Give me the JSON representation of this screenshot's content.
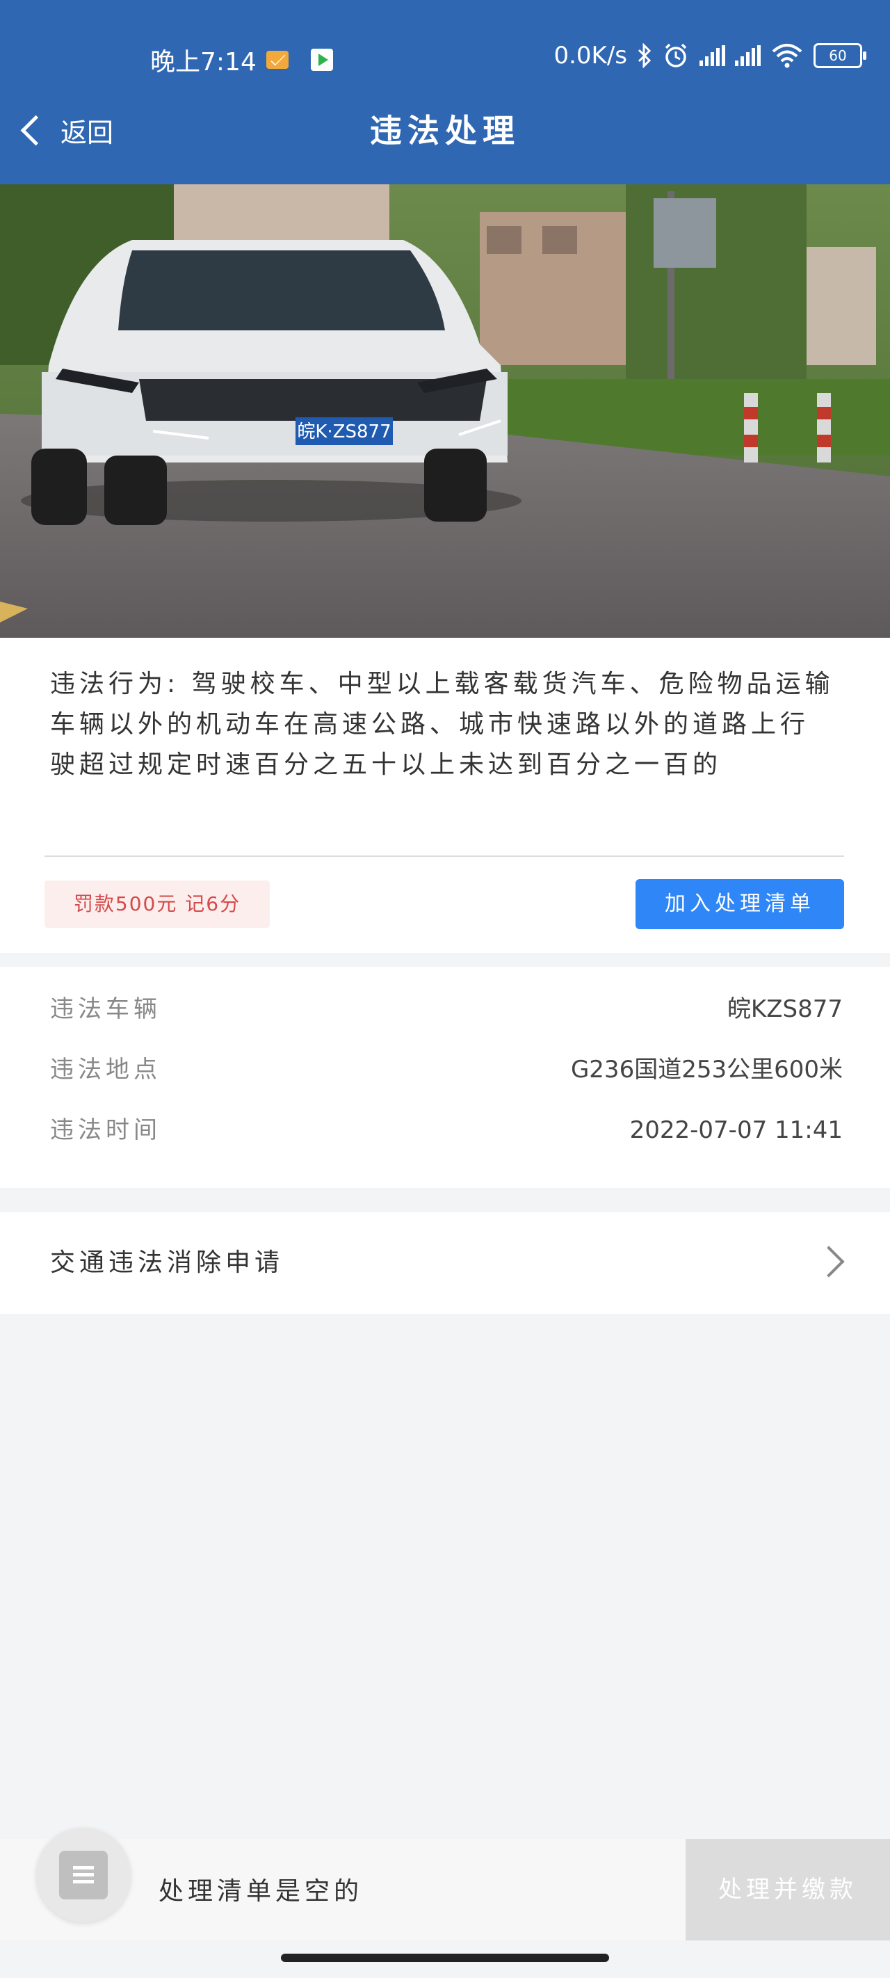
{
  "status_bar": {
    "time": "晚上7:14",
    "network_speed": "0.0K/s",
    "battery": "60",
    "icons": [
      "mail-icon",
      "play-store-icon",
      "bluetooth-icon",
      "alarm-icon",
      "signal-icon",
      "wifi-icon",
      "battery-icon"
    ]
  },
  "nav": {
    "back_label": "返回",
    "title": "违法处理"
  },
  "violation": {
    "behavior_label": "违法行为:",
    "behavior_text": "驾驶校车、中型以上载客载货汽车、危险物品运输车辆以外的机动车在高速公路、城市快速路以外的道路上行驶超过规定时速百分之五十以上未达到百分之一百的",
    "penalty": "罚款500元 记6分",
    "add_button": "加入处理清单",
    "plate_in_photo": "皖K·ZS877"
  },
  "details": [
    {
      "label": "违法车辆",
      "value": "皖KZS877"
    },
    {
      "label": "违法地点",
      "value": "G236国道253公里600米"
    },
    {
      "label": "违法时间",
      "value": "2022-07-07 11:41"
    }
  ],
  "appeal": {
    "label": "交通违法消除申请"
  },
  "bottom": {
    "empty_text": "处理清单是空的",
    "pay_button": "处理并缴款"
  },
  "colors": {
    "header": "#2f67b3",
    "primary_button": "#2f86f6",
    "fine_text": "#d44a4a",
    "fine_bg": "#fdeeee",
    "disabled_button": "#dcdcdc"
  }
}
